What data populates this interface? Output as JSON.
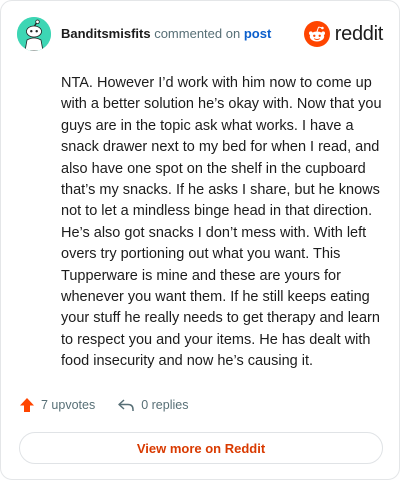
{
  "comment": {
    "author": "Banditsmisfits",
    "action_text": "commented on",
    "target_link": "post",
    "body": "NTA. However I’d work with him now to come up with a better solution he’s okay with. Now that you guys are in the topic ask what works. I have a snack drawer next to my bed for when I read, and also have one spot on the shelf in the cupboard that’s my snacks. If he asks I share, but he knows not to let a mindless binge head in that direction. He’s also got snacks I don’t mess with. With left overs try portioning out what you want. This Tupperware is mine and these are yours for whenever you want them. If he still keeps eating your stuff he really needs to get therapy and learn to respect you and your items. He has dealt with food insecurity and now he’s causing it."
  },
  "brand": {
    "wordmark": "reddit",
    "icon": "reddit-logo-icon",
    "color": "#ff4500"
  },
  "actions": {
    "upvotes_label": "7 upvotes",
    "replies_label": "0 replies",
    "upvote_icon": "upvote-arrow-icon",
    "reply_icon": "reply-arrow-icon"
  },
  "cta": {
    "label": "View more on Reddit"
  },
  "colors": {
    "accent": "#d93a00",
    "avatar_bg": "#3dd6b4",
    "link": "#0b5fcc",
    "upvote": "#ff4500"
  }
}
